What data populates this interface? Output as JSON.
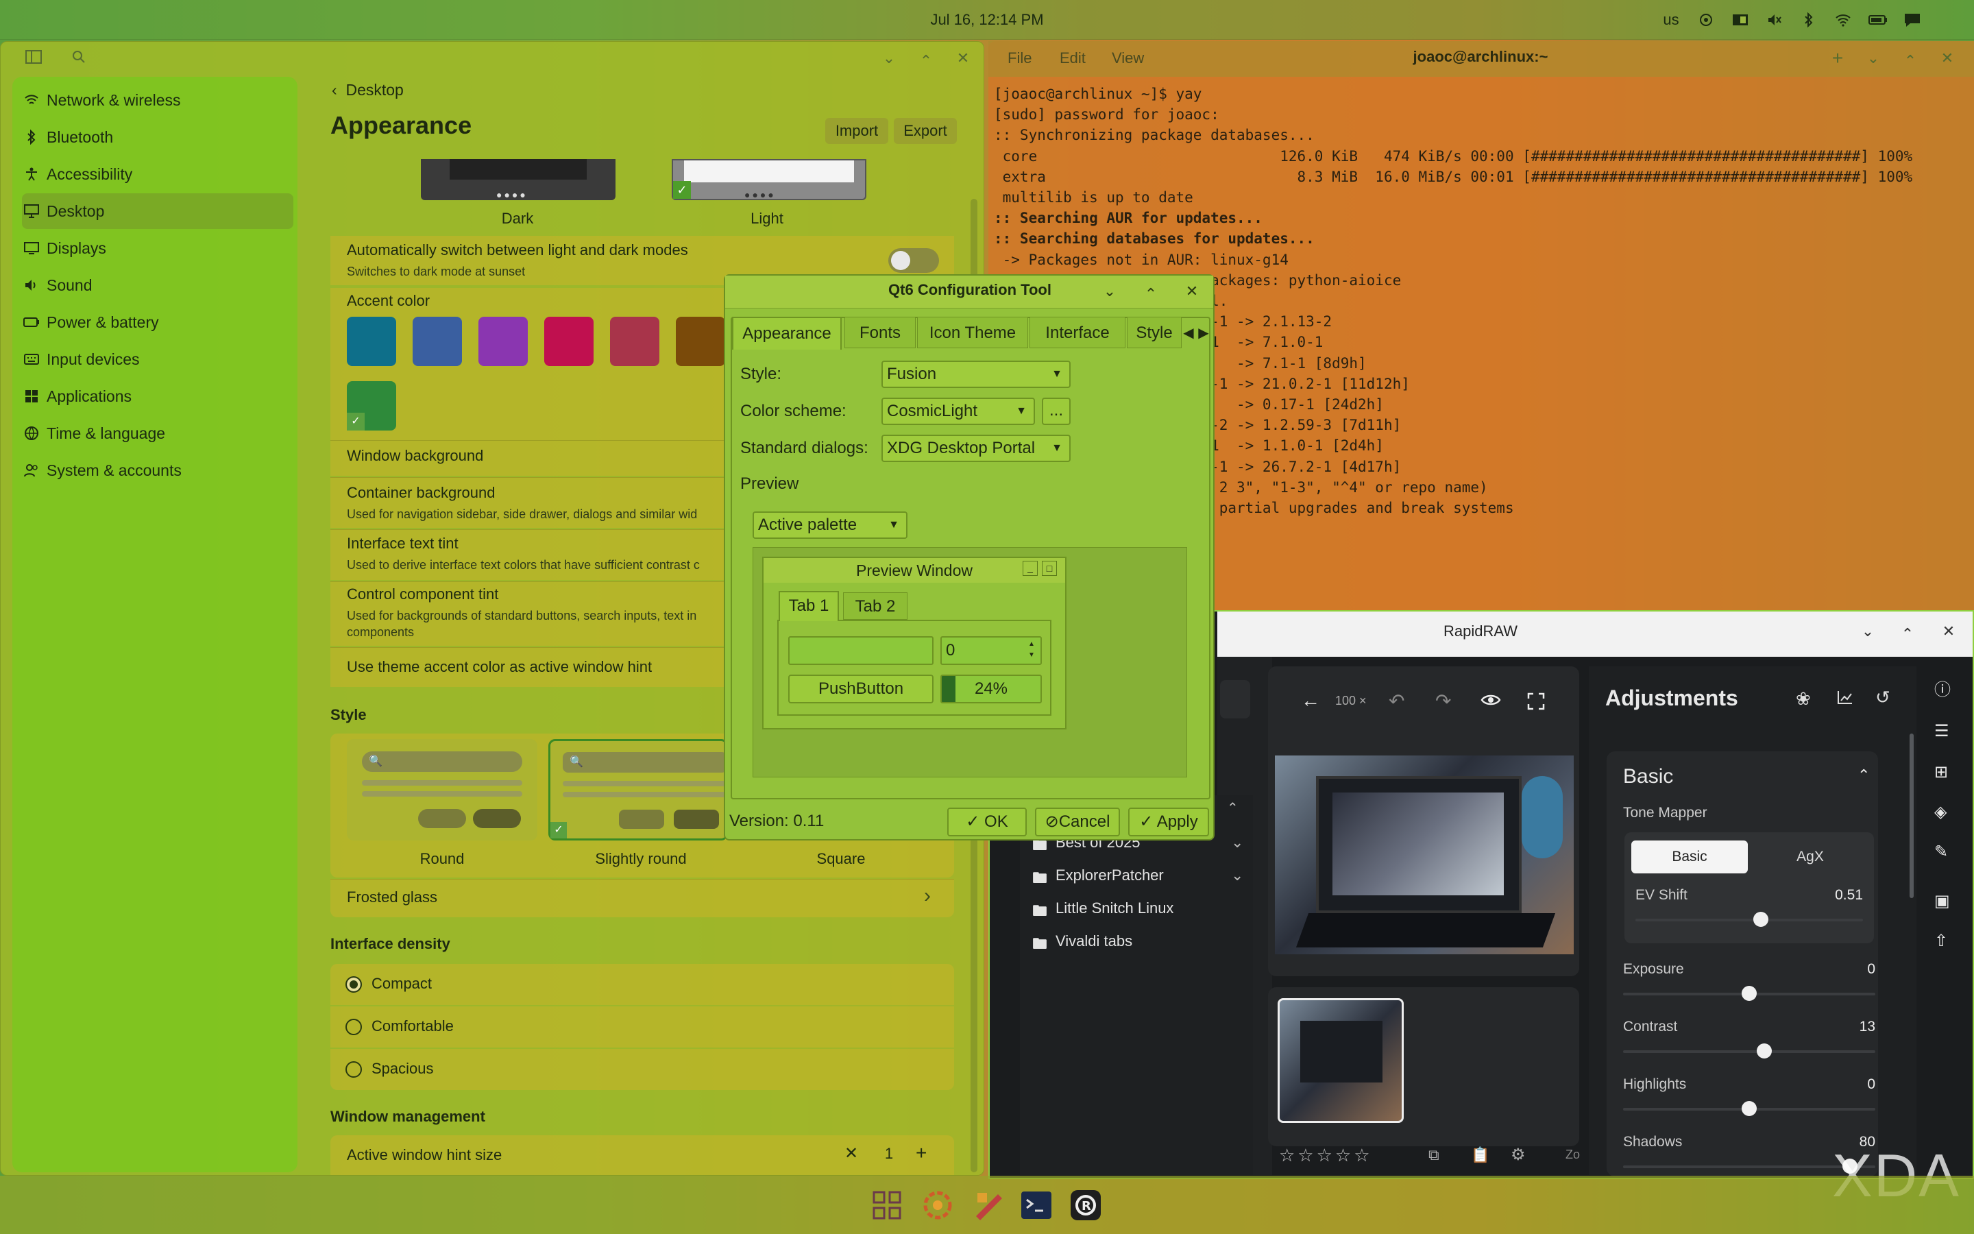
{
  "topbar": {
    "clock": "Jul 16, 12:14 PM",
    "keyboard": "us",
    "tray_icons": [
      "sync-icon",
      "window-icon",
      "mute-icon",
      "bluetooth-icon",
      "wifi-icon",
      "battery-icon",
      "notification-icon"
    ]
  },
  "settings": {
    "sidebar": {
      "items": [
        {
          "label": "Network & wireless",
          "icon": "wifi-icon"
        },
        {
          "label": "Bluetooth",
          "icon": "bluetooth-icon"
        },
        {
          "label": "Accessibility",
          "icon": "accessibility-icon"
        },
        {
          "label": "Desktop",
          "icon": "desktop-icon",
          "active": true
        },
        {
          "label": "Displays",
          "icon": "display-icon"
        },
        {
          "label": "Sound",
          "icon": "speaker-icon"
        },
        {
          "label": "Power & battery",
          "icon": "battery-icon"
        },
        {
          "label": "Input devices",
          "icon": "keyboard-icon"
        },
        {
          "label": "Applications",
          "icon": "apps-icon"
        },
        {
          "label": "Time & language",
          "icon": "globe-icon"
        },
        {
          "label": "System & accounts",
          "icon": "users-icon"
        }
      ]
    },
    "breadcrumb": "Desktop",
    "page_title": "Appearance",
    "import_label": "Import",
    "export_label": "Export",
    "mode_dark": "Dark",
    "mode_light": "Light",
    "auto_switch": {
      "title": "Automatically switch between light and dark modes",
      "subtitle": "Switches to dark mode at sunset"
    },
    "accent_color_label": "Accent color",
    "accent_colors": [
      "#0e6f8a",
      "#3a5fa0",
      "#8a36b0",
      "#c0104f",
      "#a8344a",
      "#7a4a0a"
    ],
    "custom_accent": "#2e8a3a",
    "window_background": "Window background",
    "container_background": {
      "title": "Container background",
      "subtitle": "Used for navigation sidebar, side drawer, dialogs and similar wid"
    },
    "interface_text_tint": {
      "title": "Interface text tint",
      "subtitle": "Used to derive interface text colors that have sufficient contrast c"
    },
    "control_component_tint": {
      "title": "Control component tint",
      "subtitle1": "Used for backgrounds of standard buttons, search inputs, text in",
      "subtitle2": "components"
    },
    "theme_accent_hint": "Use theme accent color as active window hint",
    "style_label": "Style",
    "style_round": "Round",
    "style_slightly_round": "Slightly round",
    "style_square": "Square",
    "frosted_glass": "Frosted glass",
    "interface_density_label": "Interface density",
    "density_options": [
      "Compact",
      "Comfortable",
      "Spacious"
    ],
    "window_management_label": "Window management",
    "active_window_hint_size": {
      "label": "Active window hint size",
      "value": "1"
    }
  },
  "terminal": {
    "menu": [
      "File",
      "Edit",
      "View"
    ],
    "title": "joaoc@archlinux:~",
    "lines": [
      {
        "text": "[joaoc@archlinux ~]$ yay",
        "bold": false
      },
      {
        "text": "[sudo] password for joaoc:",
        "bold": false
      },
      {
        "text": ":: Synchronizing package databases...",
        "bold": false
      },
      {
        "text": " core                            126.0 KiB   474 KiB/s 00:00 [######################################] 100%",
        "bold": false
      },
      {
        "text": " extra                             8.3 MiB  16.0 MiB/s 00:01 [######################################] 100%",
        "bold": false
      },
      {
        "text": " multilib is up to date",
        "bold": false
      },
      {
        "text": ":: Searching AUR for updates...",
        "bold": true
      },
      {
        "text": ":: Searching databases for updates...",
        "bold": true
      },
      {
        "text": " -> Packages not in AUR: linux-g14",
        "bold": false
      },
      {
        "text": "                    AUR Packages: python-aioice",
        "bold": false
      },
      {
        "text": "                   install.",
        "bold": false
      },
      {
        "text": "                   2.1.13-1 -> 2.1.13-2",
        "bold": false
      },
      {
        "text": "                   7.0.1-1  -> 7.1.0-1",
        "bold": false
      },
      {
        "text": "                   6.19-2   -> 7.1-1 [8d9h]",
        "bold": false
      },
      {
        "text": "                   20.3.2-1 -> 21.0.2-1 [11d12h]",
        "bold": false
      },
      {
        "text": "                   0.16-1   -> 0.17-1 [24d2h]",
        "bold": false
      },
      {
        "text": "                   1.2.59-2 -> 1.2.59-3 [7d11h]",
        "bold": false
      },
      {
        "text": "                   1.0.9-1  -> 1.1.0-1 [2d4h]",
        "bold": false
      },
      {
        "text": "                   26.6.3-1 -> 26.7.2-1 [4d17h]",
        "bold": false
      },
      {
        "text": "                   eg: \"1 2 3\", \"1-3\", \"^4\" or repo name)",
        "bold": false
      },
      {
        "text": "                    cause partial upgrades and break systems",
        "bold": false
      }
    ]
  },
  "qt6": {
    "title": "Qt6 Configuration Tool",
    "tabs": [
      "Appearance",
      "Fonts",
      "Icon Theme",
      "Interface",
      "Style"
    ],
    "style_label": "Style:",
    "style_value": "Fusion",
    "color_scheme_label": "Color scheme:",
    "color_scheme_value": "CosmicLight",
    "more_button": "...",
    "standard_dialogs_label": "Standard dialogs:",
    "standard_dialogs_value": "XDG Desktop Portal",
    "preview_label": "Preview",
    "palette_value": "Active palette",
    "preview_window_title": "Preview Window",
    "preview_tabs": [
      "Tab 1",
      "Tab 2"
    ],
    "spin_value": "0",
    "push_button": "PushButton",
    "progress_text": "24%",
    "progress_value": 0.24,
    "version": "Version: 0.11",
    "ok": "OK",
    "cancel": "Cancel",
    "apply": "Apply"
  },
  "rapidraw": {
    "title": "RapidRAW",
    "zoom_value": "100 ×",
    "folders": [
      "Best of 2025",
      "ExplorerPatcher",
      "Little Snitch Linux",
      "Vivaldi tabs"
    ],
    "adjustments_title": "Adjustments",
    "basic_section": "Basic",
    "tone_mapper_label": "Tone Mapper",
    "tone_mapper_options": [
      "Basic",
      "AgX"
    ],
    "sliders": [
      {
        "label": "EV Shift",
        "value": "0.51",
        "fraction": 0.55
      },
      {
        "label": "Exposure",
        "value": "0",
        "fraction": 0.5
      },
      {
        "label": "Contrast",
        "value": "13",
        "fraction": 0.56
      },
      {
        "label": "Highlights",
        "value": "0",
        "fraction": 0.5
      },
      {
        "label": "Shadows",
        "value": "80",
        "fraction": 0.9
      }
    ],
    "zoom_short": "Zo"
  },
  "watermark": "XDA",
  "taskbar": {
    "apps": [
      "app-grid-icon",
      "settings-app-icon",
      "store-app-icon",
      "terminal-app-icon",
      "rapidraw-app-icon"
    ]
  }
}
